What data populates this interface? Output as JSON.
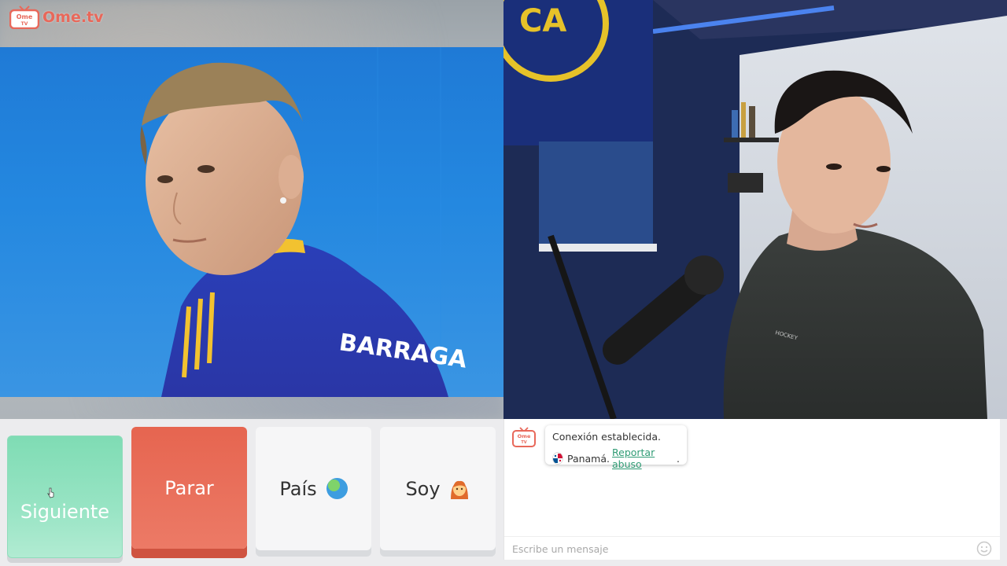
{
  "app": {
    "logo_text": "Ome.tv",
    "logo_badge_top": "Ome",
    "logo_badge_bottom": "TV"
  },
  "stranger_video": {
    "jersey_name": "BARRAGA"
  },
  "controls": {
    "next_label": "Siguiente",
    "stop_label": "Parar",
    "country_label": "País",
    "country_icon": "globe-icon",
    "gender_label": "Soy",
    "gender_icon": "woman-emoji-icon"
  },
  "chat": {
    "system_messages": [
      {
        "line1": "Conexión establecida.",
        "country": "Panamá.",
        "country_flag": "panama-flag-icon",
        "report_link": "Reportar abuso"
      }
    ],
    "input_placeholder": "Escribe un mensaje",
    "emoji_button_icon": "smiley-icon"
  },
  "colors": {
    "brand": "#e8685a",
    "next_button": "#8fdfbd",
    "stop_button": "#e8705c",
    "link": "#2f9b74"
  }
}
